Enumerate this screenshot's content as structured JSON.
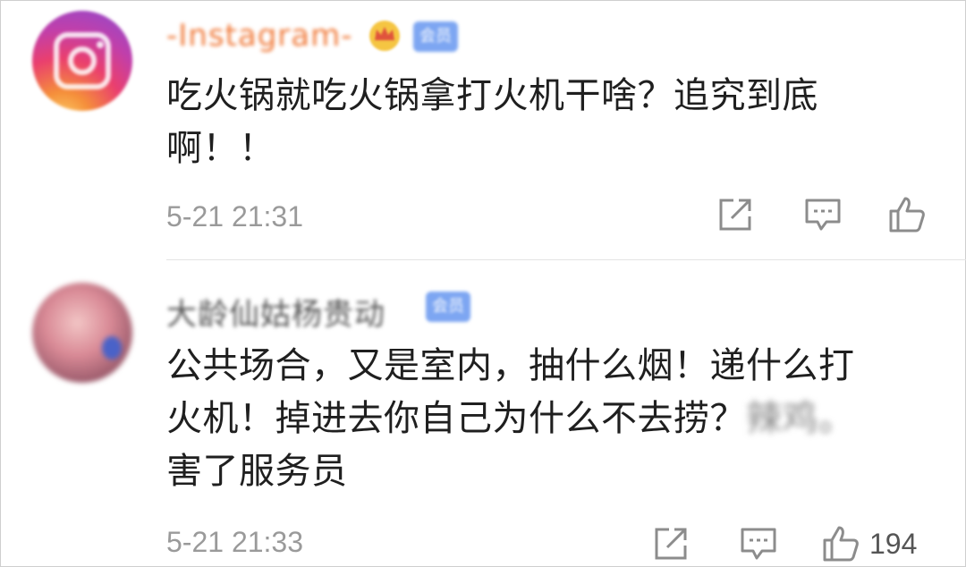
{
  "comments": [
    {
      "username": "-Instagram-",
      "vip_badge": "会员",
      "text_lines": [
        "吃火锅就吃火锅拿打火机干啥？追究到底",
        "啊！！"
      ],
      "time": "5-21 21:31",
      "likes": ""
    },
    {
      "username": "大龄仙姑杨贵动",
      "vip_badge": "会员",
      "text_line1": "公共场合，又是室内，抽什么烟！递什么打",
      "text_line2_a": "火机！掉进去你自己为什么不去捞？",
      "text_line2_blur": "辣鸡",
      "text_line2_b": "。",
      "text_line3": "害了服务员",
      "time": "5-21 21:33",
      "likes": "194"
    }
  ],
  "icons": {
    "share": "share-icon",
    "comment": "comment-icon",
    "like": "like-icon"
  },
  "colors": {
    "text": "#1f1f1f",
    "meta": "#9a9a9a",
    "icon": "#8c8c8c"
  }
}
